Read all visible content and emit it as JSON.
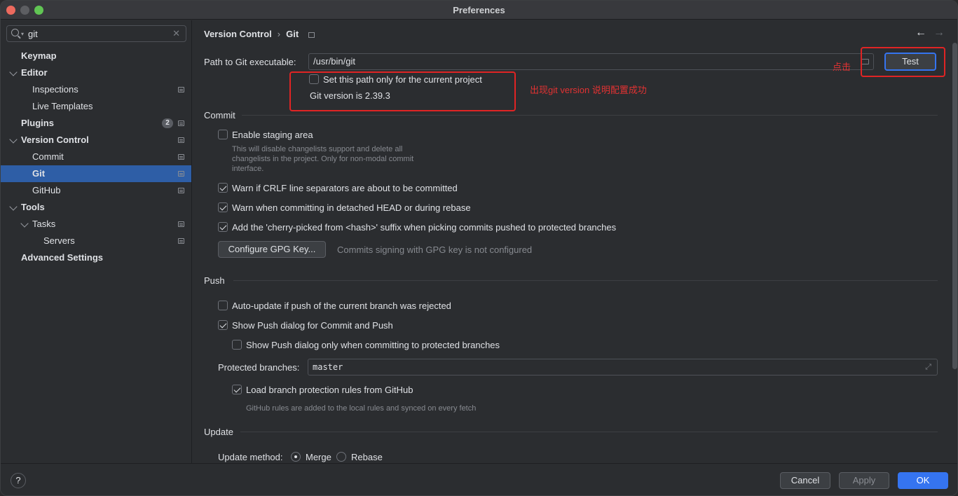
{
  "window": {
    "title": "Preferences"
  },
  "sidebar": {
    "search_value": "git",
    "items": [
      {
        "label": "Keymap"
      },
      {
        "label": "Editor"
      },
      {
        "label": "Inspections"
      },
      {
        "label": "Live Templates"
      },
      {
        "label": "Plugins",
        "badge": "2"
      },
      {
        "label": "Version Control"
      },
      {
        "label": "Commit"
      },
      {
        "label": "Git"
      },
      {
        "label": "GitHub"
      },
      {
        "label": "Tools"
      },
      {
        "label": "Tasks"
      },
      {
        "label": "Servers"
      },
      {
        "label": "Advanced Settings"
      }
    ]
  },
  "breadcrumb": {
    "parent": "Version Control",
    "sep": "›",
    "current": "Git"
  },
  "git": {
    "path_label": "Path to Git executable:",
    "path_value": "/usr/bin/git",
    "test_label": "Test",
    "current_project_label": "Set this path only for the current project",
    "version_text": "Git version is 2.39.3"
  },
  "annotations": {
    "click": "点击",
    "version_note": "出现git version 说明配置成功"
  },
  "commit": {
    "header": "Commit",
    "staging_label": "Enable staging area",
    "staging_desc": [
      "This will disable changelists support and delete all",
      "changelists in the project. Only for non-modal commit",
      "interface."
    ],
    "crlf_label": "Warn if CRLF line separators are about to be committed",
    "detached_label": "Warn when committing in detached HEAD or during rebase",
    "cherry_label": "Add the 'cherry-picked from <hash>' suffix when picking commits pushed to protected branches",
    "gpg_button": "Configure GPG Key...",
    "gpg_status": "Commits signing with GPG key is not configured"
  },
  "push": {
    "header": "Push",
    "autoupdate_label": "Auto-update if push of the current branch was rejected",
    "show_dialog_label": "Show Push dialog for Commit and Push",
    "protected_only_label": "Show Push dialog only when committing to protected branches",
    "protected_branches_label": "Protected branches:",
    "protected_branches_value": "master",
    "load_rules_label": "Load branch protection rules from GitHub",
    "rules_desc": "GitHub rules are added to the local rules and synced on every fetch"
  },
  "update": {
    "header": "Update",
    "method_label": "Update method:",
    "merge_label": "Merge",
    "rebase_label": "Rebase"
  },
  "footer": {
    "help": "?",
    "cancel": "Cancel",
    "apply": "Apply",
    "ok": "OK"
  },
  "colors": {
    "accent": "#3574f0",
    "annotation": "#e02424"
  }
}
